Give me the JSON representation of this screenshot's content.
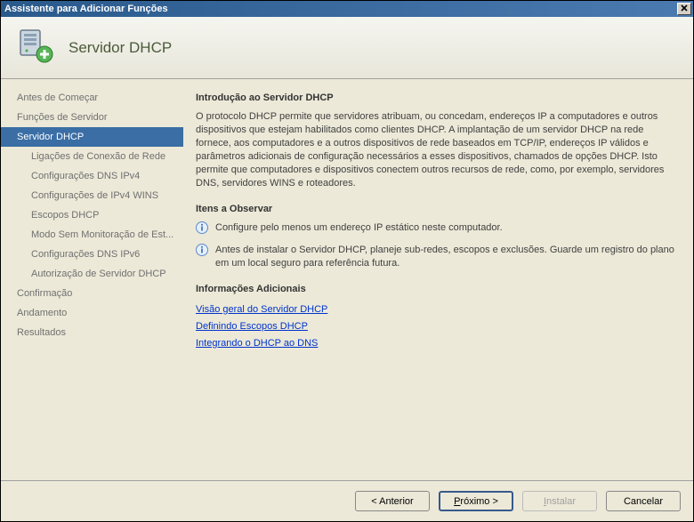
{
  "window": {
    "title": "Assistente para Adicionar Funções"
  },
  "header": {
    "title": "Servidor DHCP"
  },
  "nav": {
    "items": [
      {
        "label": "Antes de Começar",
        "sub": false,
        "selected": false
      },
      {
        "label": "Funções de Servidor",
        "sub": false,
        "selected": false
      },
      {
        "label": "Servidor DHCP",
        "sub": false,
        "selected": true
      },
      {
        "label": "Ligações de Conexão de Rede",
        "sub": true,
        "selected": false
      },
      {
        "label": "Configurações DNS IPv4",
        "sub": true,
        "selected": false
      },
      {
        "label": "Configurações de IPv4 WINS",
        "sub": true,
        "selected": false
      },
      {
        "label": "Escopos DHCP",
        "sub": true,
        "selected": false
      },
      {
        "label": "Modo Sem Monitoração de Est...",
        "sub": true,
        "selected": false
      },
      {
        "label": "Configurações DNS IPv6",
        "sub": true,
        "selected": false
      },
      {
        "label": "Autorização de Servidor DHCP",
        "sub": true,
        "selected": false
      },
      {
        "label": "Confirmação",
        "sub": false,
        "selected": false
      },
      {
        "label": "Andamento",
        "sub": false,
        "selected": false
      },
      {
        "label": "Resultados",
        "sub": false,
        "selected": false
      }
    ]
  },
  "content": {
    "intro_heading": "Introdução ao Servidor DHCP",
    "intro_text": "O protocolo DHCP permite que servidores atribuam, ou concedam, endereços IP a computadores e outros dispositivos que estejam habilitados como clientes DHCP. A implantação de um servidor DHCP na rede fornece, aos computadores e a outros dispositivos de rede baseados em TCP/IP, endereços IP válidos e parâmetros adicionais de configuração necessários a esses dispositivos, chamados de opções DHCP. Isto permite que computadores e dispositivos conectem outros recursos de rede, como, por exemplo, servidores DNS, servidores WINS e roteadores.",
    "observe_heading": "Itens a Observar",
    "observe_items": [
      "Configure pelo menos um endereço IP estático neste computador.",
      "Antes de instalar o Servidor DHCP, planeje sub-redes, escopos e exclusões. Guarde um registro do plano em um local seguro para referência futura."
    ],
    "addl_heading": "Informações Adicionais",
    "links": [
      "Visão geral do Servidor DHCP",
      "Definindo Escopos DHCP",
      "Integrando o DHCP ao DNS"
    ]
  },
  "buttons": {
    "previous": "< Anterior",
    "next": "Próximo >",
    "install": "Instalar",
    "cancel": "Cancelar"
  }
}
